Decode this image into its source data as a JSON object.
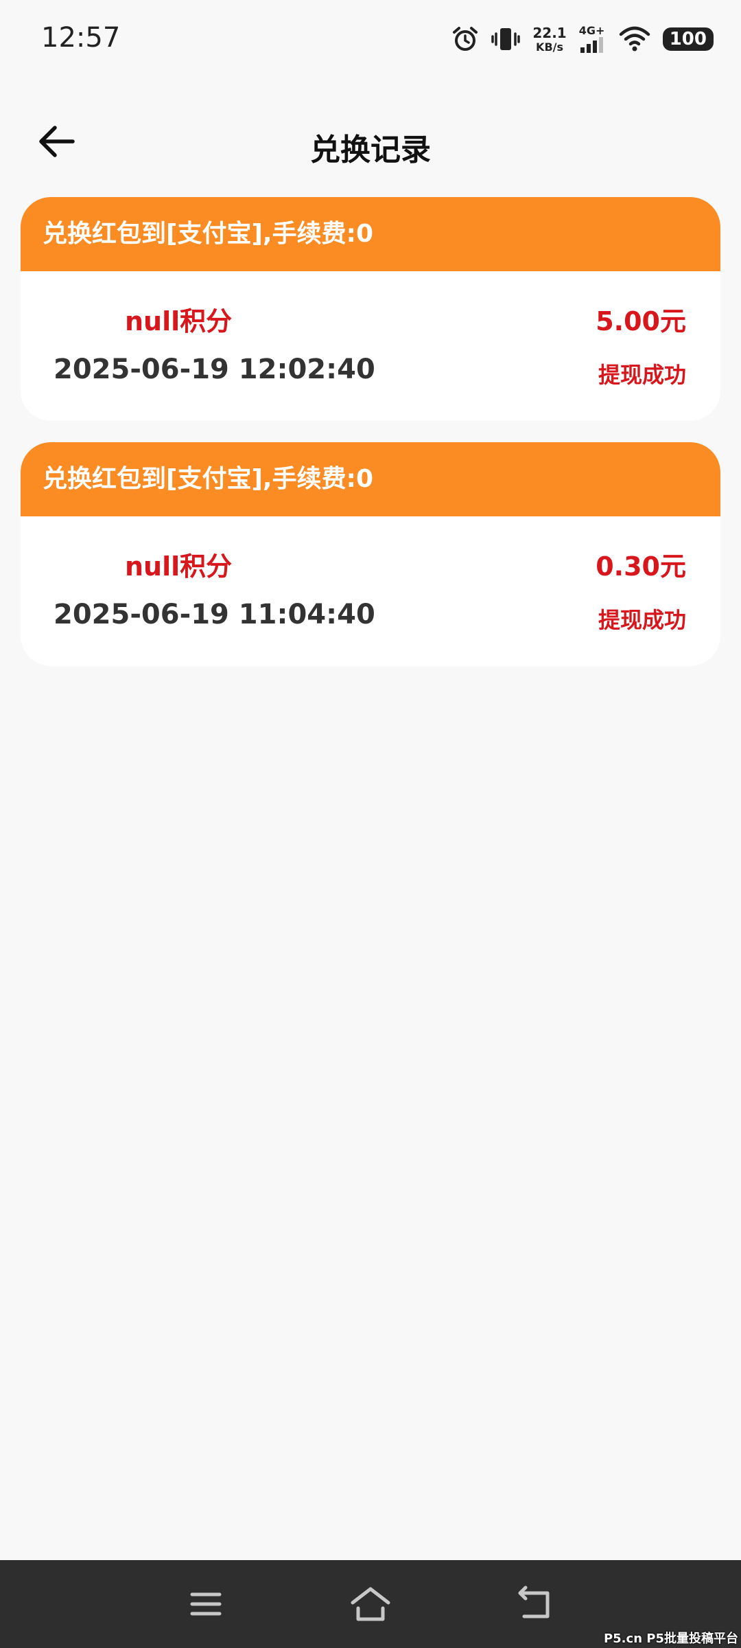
{
  "status_bar": {
    "time": "12:57",
    "net_speed_value": "22.1",
    "net_speed_unit": "KB/s",
    "network": "4G+",
    "battery": "100",
    "icons": [
      "alarm-icon",
      "vibrate-icon",
      "signal-icon",
      "wifi-icon",
      "battery-icon"
    ]
  },
  "app_bar": {
    "title": "兑换记录",
    "back_icon": "arrow-left-icon"
  },
  "records": [
    {
      "header": "兑换红包到[支付宝],手续费:0",
      "points": "null积分",
      "amount": "5.00元",
      "datetime": "2025-06-19 12:02:40",
      "status": "提现成功"
    },
    {
      "header": "兑换红包到[支付宝],手续费:0",
      "points": "null积分",
      "amount": "0.30元",
      "datetime": "2025-06-19 11:04:40",
      "status": "提现成功"
    }
  ],
  "bottom_nav": {
    "icons": [
      "menu-icon",
      "home-icon",
      "back-icon"
    ]
  },
  "watermark": "P5.cn P5批量投稿平台",
  "colors": {
    "accent_orange": "#fb8c23",
    "text_red": "#d8171c",
    "background": "#f8f8f8",
    "nav_bar": "#2e2e2e"
  }
}
